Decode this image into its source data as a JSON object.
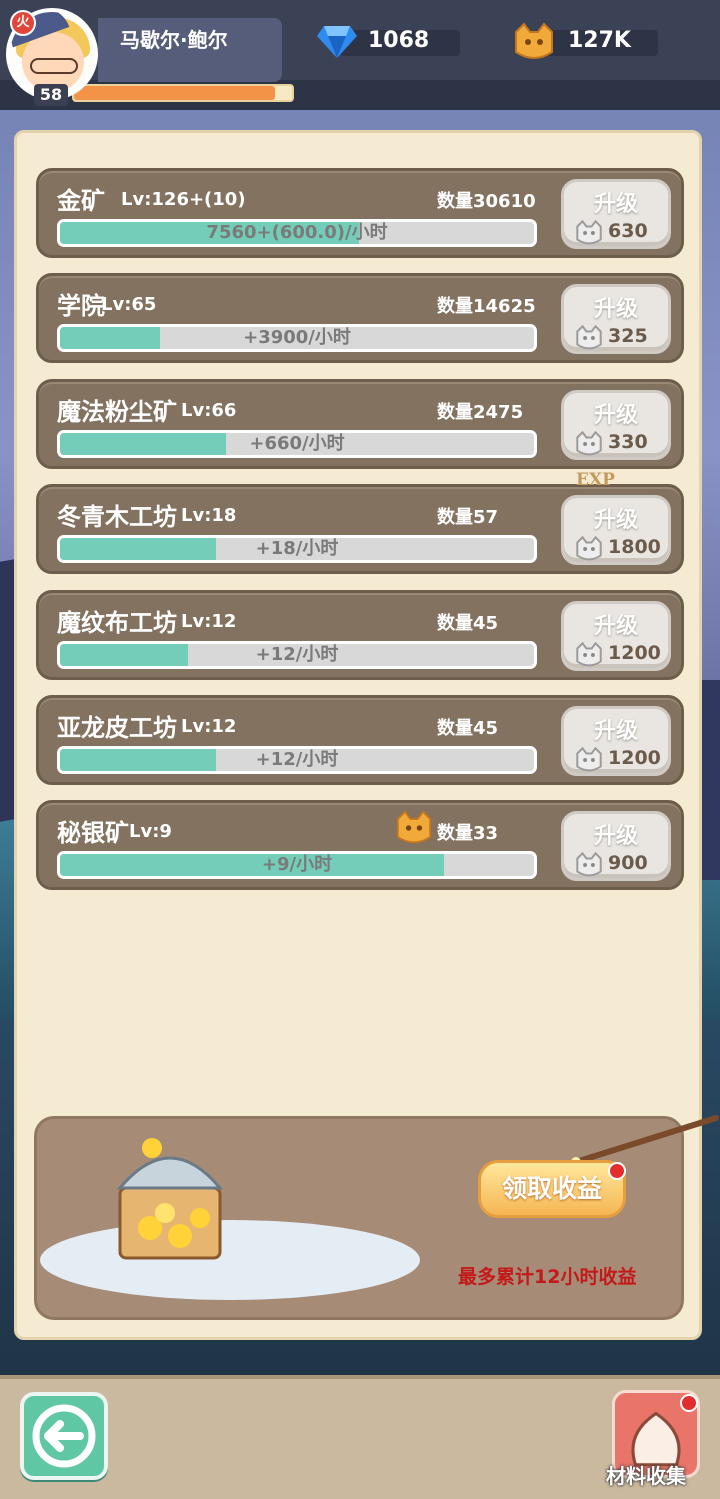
{
  "player": {
    "name": "马歇尔·鲍尔",
    "level": "58",
    "element_badge": "火",
    "exp_fraction": 0.92
  },
  "currencies": {
    "gems": "1068",
    "coins": "127K",
    "gem_icon": "diamond-icon",
    "coin_icon": "cat-coin-icon"
  },
  "resources": {
    "upgrade_label": "升级",
    "exp_tag": "EXP",
    "items": [
      {
        "name": "金矿",
        "level": "Lv:126+(10)",
        "count": "数量30610",
        "rate": "7560+(600.0)/小时",
        "progress": 0.63,
        "cost": "630"
      },
      {
        "name": "学院",
        "level": "Lv:65",
        "count": "数量14625",
        "rate": "+3900/小时",
        "progress": 0.21,
        "cost": "325"
      },
      {
        "name": "魔法粉尘矿",
        "level": "Lv:66",
        "count": "数量2475",
        "rate": "+660/小时",
        "progress": 0.35,
        "cost": "330"
      },
      {
        "name": "冬青木工坊",
        "level": "Lv:18",
        "count": "数量57",
        "rate": "+18/小时",
        "progress": 0.33,
        "cost": "1800"
      },
      {
        "name": "魔纹布工坊",
        "level": "Lv:12",
        "count": "数量45",
        "rate": "+12/小时",
        "progress": 0.27,
        "cost": "1200"
      },
      {
        "name": "亚龙皮工坊",
        "level": "Lv:12",
        "count": "数量45",
        "rate": "+12/小时",
        "progress": 0.33,
        "cost": "1200"
      },
      {
        "name": "秘银矿",
        "level": "Lv:9",
        "count": "数量33",
        "rate": "+9/小时",
        "progress": 0.81,
        "cost": "900"
      }
    ]
  },
  "treasure": {
    "collect_label": "领取收益",
    "note": "最多累计12小时收益"
  },
  "bottom": {
    "collection_label": "材料收集"
  },
  "colors": {
    "bar_fill": "#73cdb8",
    "row_bg": "#83725f",
    "panel_bg": "#f5ebd2",
    "accent_orange": "#f29347",
    "note_red": "#c41919"
  }
}
